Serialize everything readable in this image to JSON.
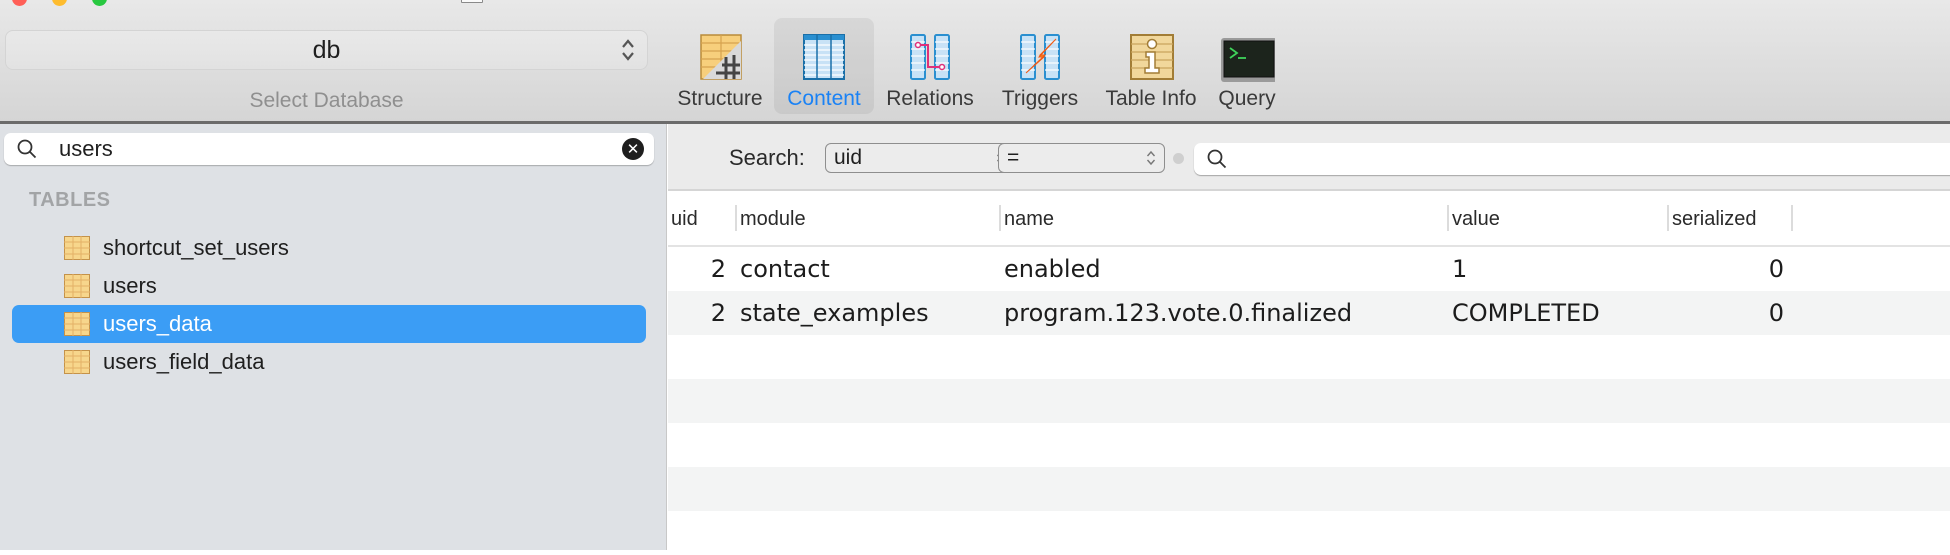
{
  "window": {
    "controls": [
      "close",
      "minimize",
      "zoom"
    ]
  },
  "toolbar": {
    "database": {
      "selected": "db",
      "caption": "Select Database"
    },
    "buttons": [
      {
        "id": "structure",
        "label": "Structure",
        "icon": "structure-icon",
        "active": false
      },
      {
        "id": "content",
        "label": "Content",
        "icon": "content-table-icon",
        "active": true
      },
      {
        "id": "relations",
        "label": "Relations",
        "icon": "relations-icon",
        "active": false
      },
      {
        "id": "triggers",
        "label": "Triggers",
        "icon": "triggers-icon",
        "active": false
      },
      {
        "id": "table_info",
        "label": "Table Info",
        "icon": "info-icon",
        "active": false
      },
      {
        "id": "query",
        "label": "Query",
        "icon": "terminal-icon",
        "active": false
      }
    ],
    "active_color": "#1a82f5"
  },
  "sidebar": {
    "filter": {
      "value": "users",
      "placeholder": ""
    },
    "section_title": "TABLES",
    "tables": [
      {
        "name": "shortcut_set_users",
        "selected": false
      },
      {
        "name": "users",
        "selected": false
      },
      {
        "name": "users_data",
        "selected": true
      },
      {
        "name": "users_field_data",
        "selected": false
      }
    ],
    "selection_color": "#3b9df5"
  },
  "content": {
    "search": {
      "label": "Search:",
      "field": "uid",
      "operator": "=",
      "value": ""
    },
    "columns": [
      "uid",
      "module",
      "name",
      "value",
      "serialized"
    ],
    "rows": [
      {
        "uid": "2",
        "module": "contact",
        "name": "enabled",
        "value": "1",
        "serialized": "0"
      },
      {
        "uid": "2",
        "module": "state_examples",
        "name": "program.123.vote.0.finalized",
        "value": "COMPLETED",
        "serialized": "0"
      }
    ]
  }
}
